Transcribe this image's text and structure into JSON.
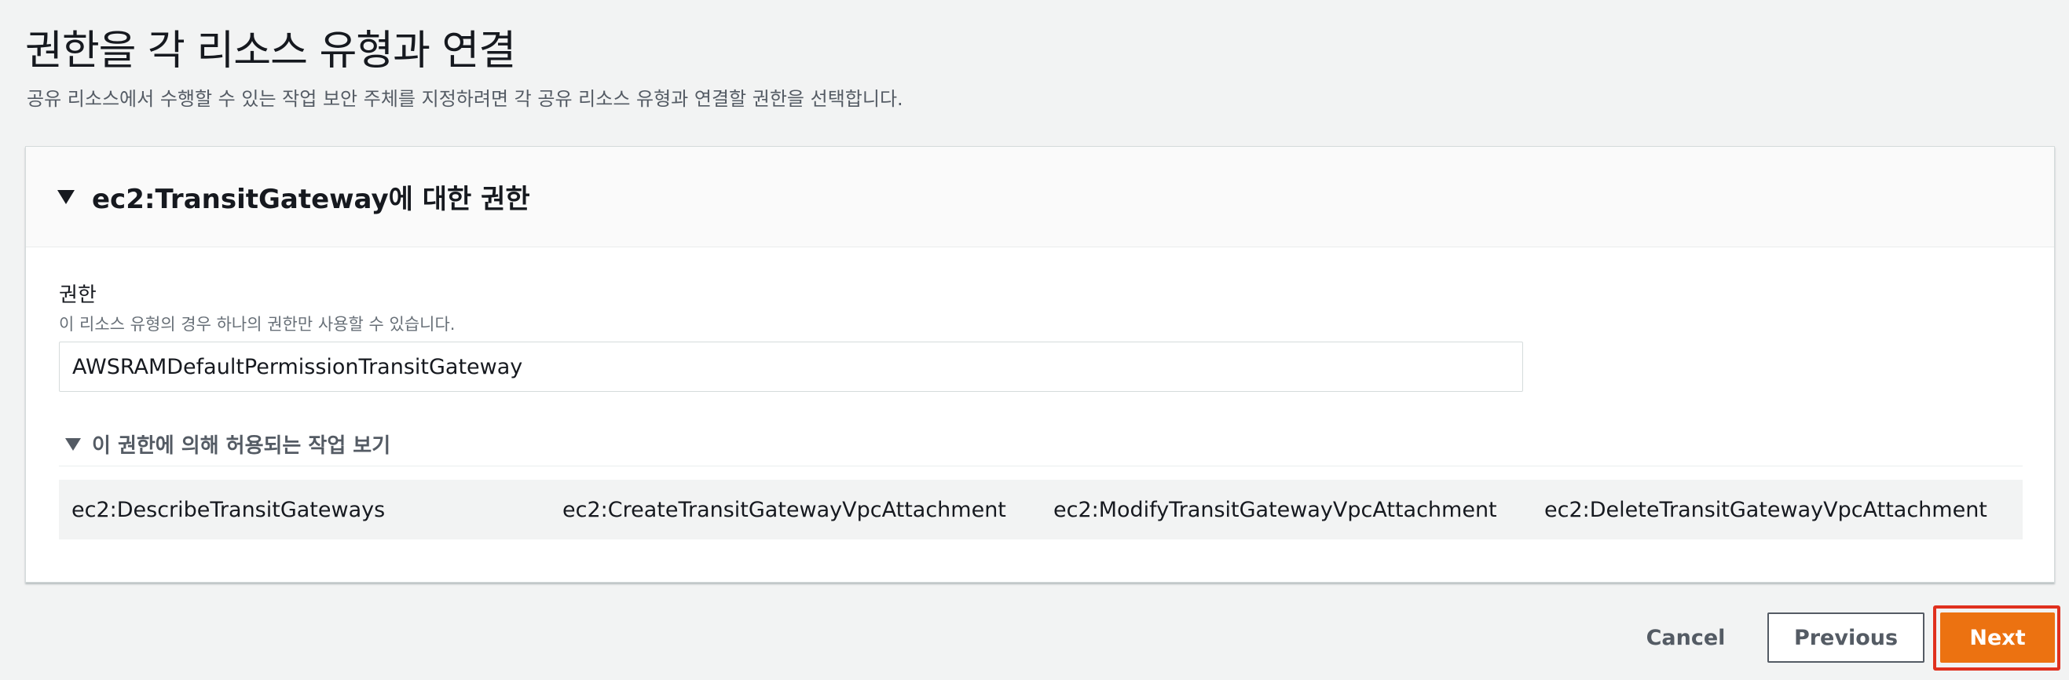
{
  "page": {
    "title": "권한을 각 리소스 유형과 연결",
    "description": "공유 리소스에서 수행할 수 있는 작업 보안 주체를 지정하려면 각 공유 리소스 유형과 연결할 권한을 선택합니다."
  },
  "panel": {
    "title": "ec2:TransitGateway에 대한 권한",
    "permission_label": "권한",
    "permission_description": "이 리소스 유형의 경우 하나의 권한만 사용할 수 있습니다.",
    "permission_value": "AWSRAMDefaultPermissionTransitGateway",
    "actions_toggle_label": "이 권한에 의해 허용되는 작업 보기",
    "actions": [
      "ec2:DescribeTransitGateways",
      "ec2:CreateTransitGatewayVpcAttachment",
      "ec2:ModifyTransitGatewayVpcAttachment",
      "ec2:DeleteTransitGatewayVpcAttachment"
    ]
  },
  "footer": {
    "cancel_label": "Cancel",
    "previous_label": "Previous",
    "next_label": "Next"
  },
  "colors": {
    "primary": "#ec7211",
    "highlight": "#e0301e",
    "background": "#f2f3f3"
  },
  "icons": {
    "panel_toggle": "caret-down-icon",
    "actions_toggle": "caret-down-icon"
  }
}
